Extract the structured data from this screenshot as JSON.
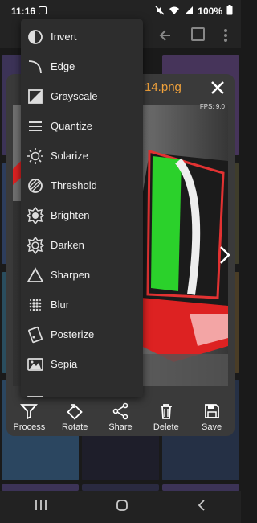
{
  "status": {
    "time": "11:16",
    "battery": "100%"
  },
  "dialog": {
    "title": "14.png",
    "fps": "FPS: 9.0"
  },
  "menu": {
    "items": [
      {
        "label": "Invert",
        "icon": "invert-icon"
      },
      {
        "label": "Edge",
        "icon": "edge-icon"
      },
      {
        "label": "Grayscale",
        "icon": "grayscale-icon"
      },
      {
        "label": "Quantize",
        "icon": "quantize-icon"
      },
      {
        "label": "Solarize",
        "icon": "solarize-icon"
      },
      {
        "label": "Threshold",
        "icon": "threshold-icon"
      },
      {
        "label": "Brighten",
        "icon": "brighten-icon"
      },
      {
        "label": "Darken",
        "icon": "darken-icon"
      },
      {
        "label": "Sharpen",
        "icon": "sharpen-icon"
      },
      {
        "label": "Blur",
        "icon": "blur-icon"
      },
      {
        "label": "Posterize",
        "icon": "posterize-icon"
      },
      {
        "label": "Sepia",
        "icon": "sepia-icon"
      }
    ]
  },
  "toolbar": {
    "process": "Process",
    "rotate": "Rotate",
    "share": "Share",
    "delete": "Delete",
    "save": "Save"
  },
  "colors": {
    "accent": "#f2a23a",
    "dialog_bg": "#3a3a3a",
    "menu_bg": "#2d2d2d"
  }
}
